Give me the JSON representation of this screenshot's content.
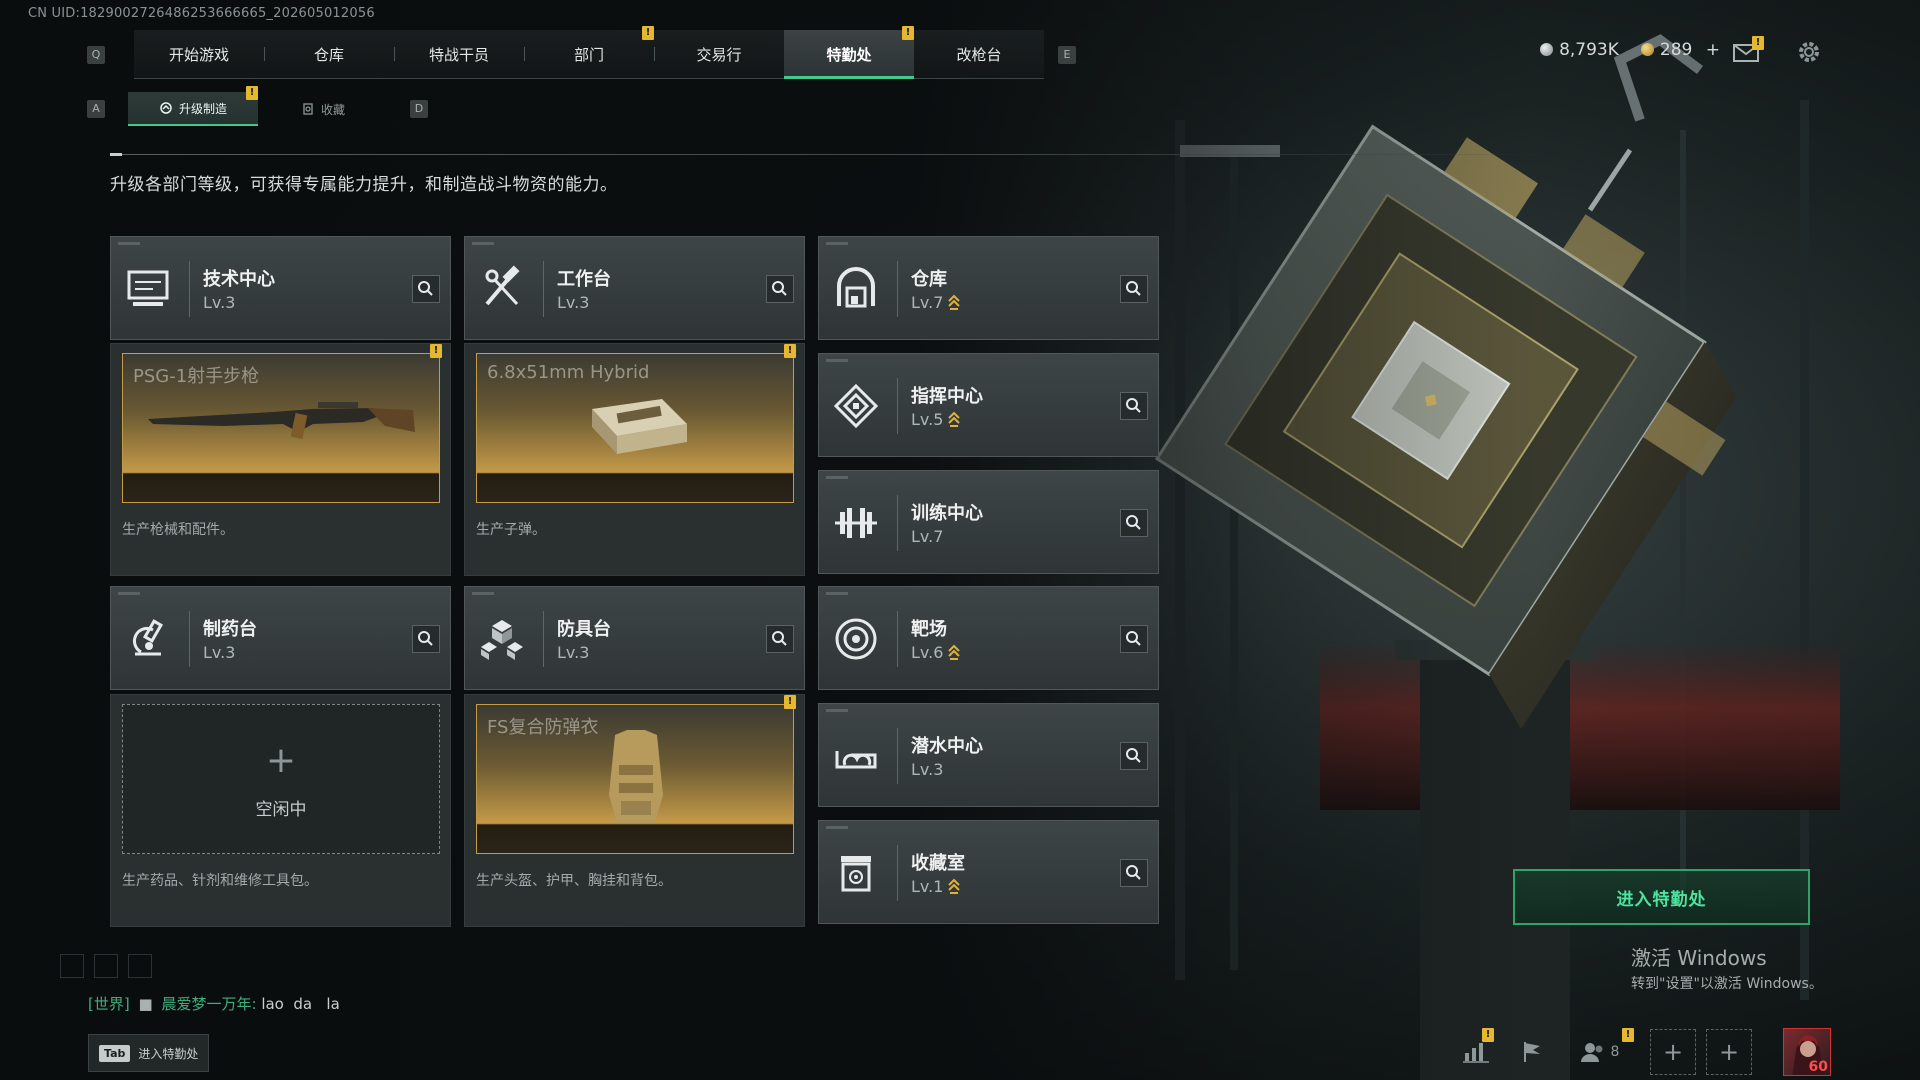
{
  "uid_text": "CN UID:1829002726486253666665_202605012056",
  "keycaps": {
    "left_main": "Q",
    "right_main": "E",
    "left_sub": "A",
    "right_sub": "D"
  },
  "main_nav": {
    "tabs": [
      {
        "label": "开始游戏",
        "active": false,
        "badge": false
      },
      {
        "label": "仓库",
        "active": false,
        "badge": false
      },
      {
        "label": "特战干员",
        "active": false,
        "badge": false
      },
      {
        "label": "部门",
        "active": false,
        "badge": true
      },
      {
        "label": "交易行",
        "active": false,
        "badge": false
      },
      {
        "label": "特勤处",
        "active": true,
        "badge": true
      },
      {
        "label": "改枪台",
        "active": false,
        "badge": false
      }
    ],
    "badge_glyph": "!"
  },
  "currency": {
    "silver": "8,793K",
    "gold": "289",
    "add": "+"
  },
  "sub_nav": {
    "tabs": [
      {
        "label": "升级制造",
        "active": true,
        "icon": "upgrade-icon"
      },
      {
        "label": "收藏",
        "active": false,
        "icon": "collection-icon"
      }
    ]
  },
  "description": "升级各部门等级，可获得专属能力提升，和制造战斗物资的能力。",
  "departments": [
    {
      "name": "技术中心",
      "level": "Lv.3",
      "upgradable": false,
      "icon": "tech-center-icon"
    },
    {
      "name": "工作台",
      "level": "Lv.3",
      "upgradable": false,
      "icon": "workbench-icon"
    },
    {
      "name": "仓库",
      "level": "Lv.7",
      "upgradable": true,
      "icon": "warehouse-icon"
    },
    {
      "name": "指挥中心",
      "level": "Lv.5",
      "upgradable": true,
      "icon": "command-center-icon"
    },
    {
      "name": "训练中心",
      "level": "Lv.7",
      "upgradable": false,
      "icon": "training-center-icon"
    },
    {
      "name": "制药台",
      "level": "Lv.3",
      "upgradable": false,
      "icon": "pharmacy-icon"
    },
    {
      "name": "防具台",
      "level": "Lv.3",
      "upgradable": false,
      "icon": "armor-bench-icon"
    },
    {
      "name": "靶场",
      "level": "Lv.6",
      "upgradable": true,
      "icon": "shooting-range-icon"
    },
    {
      "name": "潜水中心",
      "level": "Lv.3",
      "upgradable": false,
      "icon": "diving-center-icon"
    },
    {
      "name": "收藏室",
      "level": "Lv.1",
      "upgradable": true,
      "icon": "collection-room-icon"
    }
  ],
  "production": [
    {
      "item": "PSG-1射手步枪",
      "desc": "生产枪械和配件。",
      "badge": true,
      "image": "rifle"
    },
    {
      "item": "6.8x51mm Hybrid",
      "desc": "生产子弹。",
      "badge": true,
      "image": "ammo-box"
    },
    {
      "item": "",
      "idle_label": "空闲中",
      "idle_plus": "+",
      "desc": "生产药品、针剂和维修工具包。",
      "badge": false,
      "image": "idle"
    },
    {
      "item": "FS复合防弹衣",
      "desc": "生产头盔、护甲、胸挂和背包。",
      "badge": true,
      "image": "vest"
    }
  ],
  "enter_button": "进入特勤处",
  "windows_activation": {
    "title": "激活 Windows",
    "subtitle": "转到\"设置\"以激活 Windows。"
  },
  "chat": {
    "channel": "[世界]",
    "sender": "晨爱梦一万年:",
    "message": "lao  da   la"
  },
  "tab_hint": {
    "key": "Tab",
    "label": "进入特勤处"
  },
  "bottom_toolbar": {
    "friends_count": "8",
    "add": "+",
    "player_level": "60"
  },
  "colors": {
    "accent_green": "#3fc98d",
    "badge_yellow": "#e6b830",
    "gold_frame": "#c69b45",
    "upgrade_gold": "#e0b23c"
  }
}
